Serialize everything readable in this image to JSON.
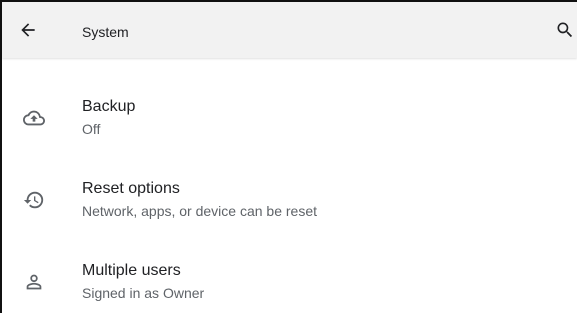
{
  "app_bar": {
    "title": "System",
    "back_icon": "arrow-back-icon",
    "search_icon": "search-icon"
  },
  "items": [
    {
      "title": "Backup",
      "summary": "Off",
      "icon": "cloud-upload-icon"
    },
    {
      "title": "Reset options",
      "summary": "Network, apps, or device can be reset",
      "icon": "history-icon"
    },
    {
      "title": "Multiple users",
      "summary": "Signed in as Owner",
      "icon": "person-icon"
    }
  ],
  "colors": {
    "app_bar_bg": "#f2f2f2",
    "title_text": "#202124",
    "summary_text": "#5f6368",
    "icon": "#5f6368"
  }
}
